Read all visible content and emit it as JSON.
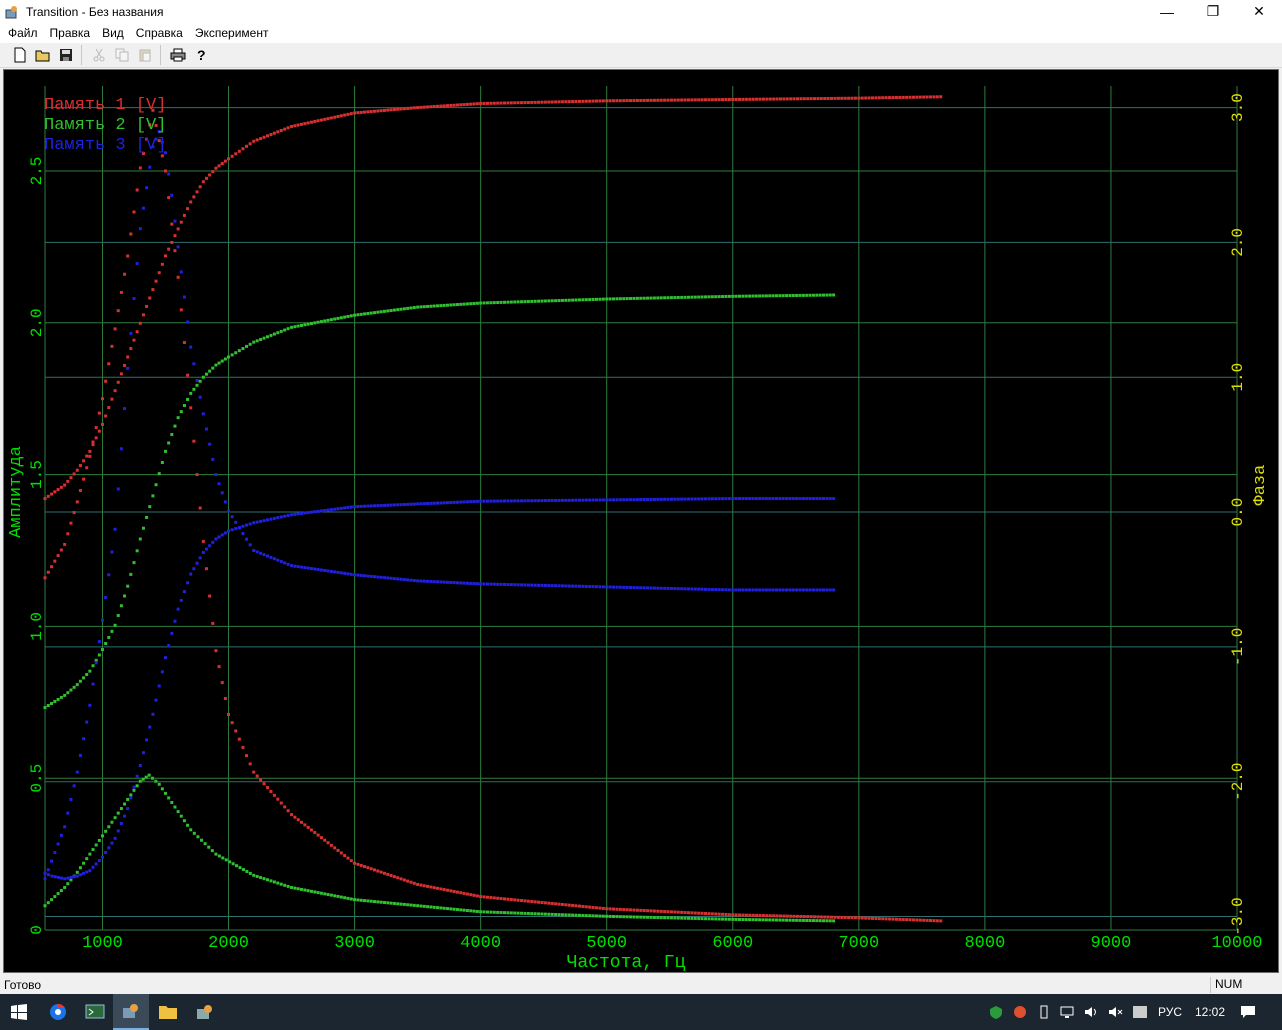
{
  "window": {
    "title": "Transition - Без названия",
    "minimize_glyph": "—",
    "maximize_glyph": "❐",
    "close_glyph": "✕"
  },
  "menu": [
    "Файл",
    "Правка",
    "Вид",
    "Справка",
    "Эксперимент"
  ],
  "toolbar": {
    "icons": [
      "new-document-icon",
      "open-folder-icon",
      "save-icon",
      "cut-icon",
      "copy-icon",
      "paste-icon",
      "print-icon",
      "help-icon"
    ]
  },
  "status": {
    "text": "Готово",
    "num": "NUM"
  },
  "taskbar": {
    "lang": "РУС",
    "time": "12:02"
  },
  "colors": {
    "background": "#000000",
    "grid": "#2e7d3e",
    "hgrid_phase": "#2f6f6f",
    "axis_text": "#00e000",
    "phase_text": "#e0e000",
    "mem1": "#d83030",
    "mem2": "#30c030",
    "mem3": "#2020e0"
  },
  "chart_data": {
    "type": "scatter",
    "xlabel": "Частота, Гц",
    "ylabel": "Амплитуда",
    "y2label": "Фаза",
    "xlim": [
      544,
      10000
    ],
    "ylim": [
      0,
      2.78
    ],
    "y2lim": [
      -3.1,
      3.16
    ],
    "x_ticks": [
      "1000",
      "2000",
      "3000",
      "4000",
      "5000",
      "6000",
      "7000",
      "8000",
      "9000",
      "10000"
    ],
    "y_ticks": [
      "0",
      "0.5",
      "1.0",
      "1.5",
      "2.0",
      "2.5"
    ],
    "y2_ticks": [
      "-3.0",
      "-2.0",
      "-1.0",
      "0.0",
      "1.0",
      "2.0",
      "3.0"
    ],
    "grid": true,
    "legend_position": "top-left",
    "series": [
      {
        "name": "Память 1 [V]",
        "color": "#d83030",
        "amplitude": {
          "x": [
            544,
            700,
            800,
            900,
            1000,
            1100,
            1200,
            1300,
            1400,
            1500,
            1600,
            1700,
            1800,
            1900,
            2000,
            2200,
            2500,
            3000,
            3500,
            4000,
            5000,
            6000,
            7000,
            7650
          ],
          "y": [
            1.16,
            1.27,
            1.41,
            1.56,
            1.75,
            1.98,
            2.22,
            2.51,
            2.7,
            2.5,
            2.15,
            1.72,
            1.28,
            0.92,
            0.71,
            0.52,
            0.38,
            0.22,
            0.15,
            0.11,
            0.07,
            0.05,
            0.04,
            0.03
          ]
        },
        "phase": {
          "x": [
            544,
            700,
            800,
            900,
            1000,
            1100,
            1200,
            1300,
            1400,
            1500,
            1600,
            1700,
            1800,
            1900,
            2000,
            2200,
            2500,
            3000,
            3500,
            4000,
            5000,
            6000,
            7000,
            7650
          ],
          "y": [
            0.1,
            0.2,
            0.31,
            0.45,
            0.65,
            0.9,
            1.15,
            1.4,
            1.65,
            1.9,
            2.1,
            2.3,
            2.45,
            2.55,
            2.62,
            2.75,
            2.86,
            2.96,
            3.0,
            3.03,
            3.05,
            3.06,
            3.07,
            3.08
          ]
        }
      },
      {
        "name": "Память 2 [V]",
        "color": "#30c030",
        "amplitude": {
          "x": [
            544,
            700,
            800,
            900,
            1000,
            1100,
            1200,
            1300,
            1370,
            1450,
            1550,
            1700,
            1900,
            2200,
            2500,
            3000,
            3500,
            4000,
            5000,
            6000,
            6800
          ],
          "y": [
            0.08,
            0.14,
            0.19,
            0.25,
            0.31,
            0.37,
            0.43,
            0.49,
            0.51,
            0.48,
            0.42,
            0.33,
            0.25,
            0.18,
            0.14,
            0.1,
            0.08,
            0.06,
            0.045,
            0.035,
            0.03
          ]
        },
        "phase": {
          "x": [
            544,
            700,
            800,
            900,
            1000,
            1100,
            1200,
            1300,
            1400,
            1500,
            1600,
            1700,
            1800,
            1900,
            2000,
            2200,
            2500,
            3000,
            3500,
            4000,
            5000,
            6000,
            6800
          ],
          "y": [
            -1.45,
            -1.36,
            -1.28,
            -1.18,
            -1.02,
            -0.84,
            -0.55,
            -0.2,
            0.12,
            0.45,
            0.7,
            0.88,
            1.0,
            1.09,
            1.15,
            1.26,
            1.37,
            1.46,
            1.52,
            1.55,
            1.58,
            1.6,
            1.61
          ]
        }
      },
      {
        "name": "Память 3 [V]",
        "color": "#2020e0",
        "amplitude": {
          "x": [
            544,
            700,
            800,
            900,
            1000,
            1100,
            1200,
            1300,
            1400,
            1450,
            1500,
            1550,
            1600,
            1700,
            1800,
            1900,
            2000,
            2200,
            2500,
            3000,
            3500,
            4000,
            5000,
            6000,
            6800
          ],
          "y": [
            0.17,
            0.34,
            0.52,
            0.74,
            1.02,
            1.32,
            1.85,
            2.31,
            2.58,
            2.63,
            2.56,
            2.42,
            2.25,
            1.92,
            1.7,
            1.5,
            1.38,
            1.25,
            1.2,
            1.17,
            1.15,
            1.14,
            1.13,
            1.12,
            1.12
          ]
        },
        "phase": {
          "x": [
            544,
            600,
            700,
            800,
            900,
            1000,
            1100,
            1200,
            1300,
            1400,
            1500,
            1600,
            1700,
            1800,
            1900,
            2000,
            2200,
            2500,
            3000,
            3500,
            4000,
            5000,
            6000,
            6800
          ],
          "y": [
            -2.68,
            -2.7,
            -2.72,
            -2.7,
            -2.66,
            -2.56,
            -2.42,
            -2.2,
            -1.88,
            -1.5,
            -1.08,
            -0.72,
            -0.46,
            -0.3,
            -0.2,
            -0.14,
            -0.08,
            -0.02,
            0.04,
            0.06,
            0.08,
            0.09,
            0.1,
            0.1
          ]
        }
      }
    ]
  }
}
